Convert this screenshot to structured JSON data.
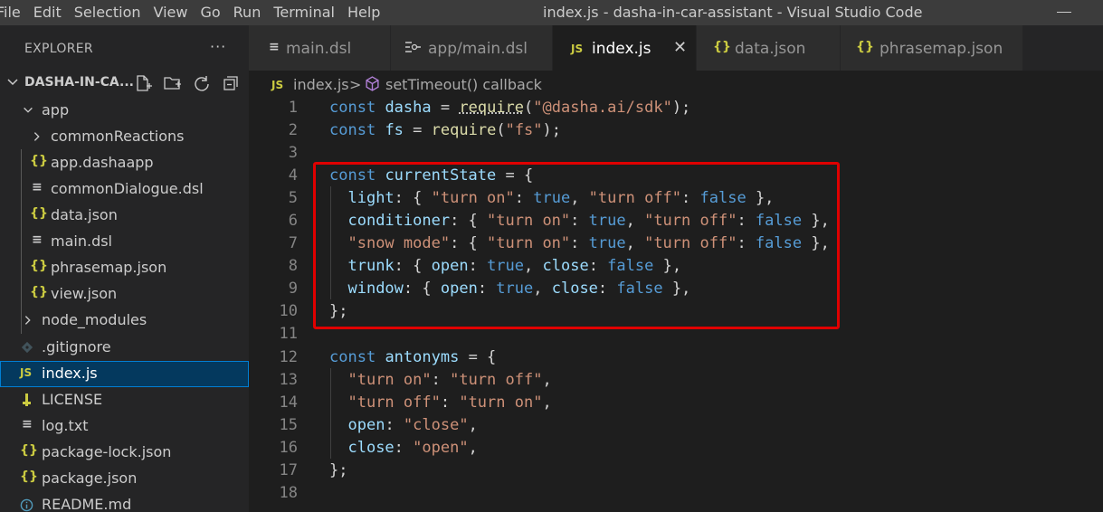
{
  "menu": [
    "File",
    "Edit",
    "Selection",
    "View",
    "Go",
    "Run",
    "Terminal",
    "Help"
  ],
  "window_title": "index.js - dasha-in-car-assistant - Visual Studio Code",
  "explorer": {
    "title": "EXPLORER",
    "more": "···",
    "workspace": "DASHA-IN-CA...",
    "tree": [
      {
        "label": "app",
        "icon": "chevron-down-icon",
        "kind": "folder"
      },
      {
        "label": "commonReactions",
        "icon": "chevron-right-icon",
        "kind": "folder"
      },
      {
        "label": "app.dashaapp",
        "icon_text": "{}",
        "kind": "json"
      },
      {
        "label": "commonDialogue.dsl",
        "icon_text": "≡",
        "kind": "text"
      },
      {
        "label": "data.json",
        "icon_text": "{}",
        "kind": "json"
      },
      {
        "label": "main.dsl",
        "icon_text": "≡",
        "kind": "text"
      },
      {
        "label": "phrasemap.json",
        "icon_text": "{}",
        "kind": "json"
      },
      {
        "label": "view.json",
        "icon_text": "{}",
        "kind": "json"
      },
      {
        "label": "node_modules",
        "icon": "chevron-right-icon",
        "kind": "folder"
      },
      {
        "label": ".gitignore",
        "icon": "git-icon",
        "kind": "git"
      },
      {
        "label": "index.js",
        "icon_text": "JS",
        "kind": "js"
      },
      {
        "label": "LICENSE",
        "icon": "license-icon",
        "kind": "license"
      },
      {
        "label": "log.txt",
        "icon_text": "≡",
        "kind": "text"
      },
      {
        "label": "package-lock.json",
        "icon_text": "{}",
        "kind": "json"
      },
      {
        "label": "package.json",
        "icon_text": "{}",
        "kind": "json"
      },
      {
        "label": "README.md",
        "icon": "info-icon",
        "kind": "info"
      }
    ]
  },
  "tabs": [
    {
      "label": "main.dsl",
      "icon_text": "≡",
      "active": false
    },
    {
      "label": "app/main.dsl",
      "icon": "dsl-file-icon",
      "active": false
    },
    {
      "label": "index.js",
      "icon_text": "JS",
      "active": true,
      "close": "✕"
    },
    {
      "label": "data.json",
      "icon_text": "{}",
      "active": false
    },
    {
      "label": "phrasemap.json",
      "icon_text": "{}",
      "active": false
    }
  ],
  "breadcrumb": {
    "file": "index.js",
    "separator": ">",
    "symbol": "setTimeout() callback"
  },
  "code_lines": [
    {
      "n": "1"
    },
    {
      "n": "2"
    },
    {
      "n": "3"
    },
    {
      "n": "4"
    },
    {
      "n": "5"
    },
    {
      "n": "6"
    },
    {
      "n": "7"
    },
    {
      "n": "8"
    },
    {
      "n": "9"
    },
    {
      "n": "10"
    },
    {
      "n": "11"
    },
    {
      "n": "12"
    },
    {
      "n": "13"
    },
    {
      "n": "14"
    },
    {
      "n": "15"
    },
    {
      "n": "16"
    },
    {
      "n": "17"
    },
    {
      "n": "18"
    }
  ],
  "code": {
    "l1": {
      "kw": "const",
      "var": "dasha",
      "eq": "=",
      "fn": "require",
      "open": "(",
      "str": "\"@dasha.ai/sdk\"",
      "close": ");"
    },
    "l2": {
      "kw": "const",
      "var": "fs",
      "eq": "=",
      "fn": "require",
      "open": "(",
      "str": "\"fs\"",
      "close": ");"
    },
    "l4": {
      "kw": "const",
      "var": "currentState",
      "rest": "= {"
    },
    "l5": {
      "key": "light",
      "a": ": { ",
      "s1": "\"turn on\"",
      "c1": ": ",
      "b1": "true",
      "m": ", ",
      "s2": "\"turn off\"",
      "c2": ": ",
      "b2": "false",
      "end": " },"
    },
    "l6": {
      "key": "conditioner",
      "a": ": { ",
      "s1": "\"turn on\"",
      "c1": ": ",
      "b1": "true",
      "m": ", ",
      "s2": "\"turn off\"",
      "c2": ": ",
      "b2": "false",
      "end": " },"
    },
    "l7": {
      "skey": "\"snow mode\"",
      "a": ": { ",
      "s1": "\"turn on\"",
      "c1": ": ",
      "b1": "true",
      "m": ", ",
      "s2": "\"turn off\"",
      "c2": ": ",
      "b2": "false",
      "end": " },"
    },
    "l8": {
      "key": "trunk",
      "a": ": { ",
      "k1": "open",
      "c1": ": ",
      "b1": "true",
      "m": ", ",
      "k2": "close",
      "c2": ": ",
      "b2": "false",
      "end": " },"
    },
    "l9": {
      "key": "window",
      "a": ": { ",
      "k1": "open",
      "c1": ": ",
      "b1": "true",
      "m": ", ",
      "k2": "close",
      "c2": ": ",
      "b2": "false",
      "end": " },"
    },
    "l10": {
      "p": "};"
    },
    "l12": {
      "kw": "const",
      "var": "antonyms",
      "rest": "= {"
    },
    "l13": {
      "s1": "\"turn on\"",
      "c": ": ",
      "s2": "\"turn off\"",
      "end": ","
    },
    "l14": {
      "s1": "\"turn off\"",
      "c": ": ",
      "s2": "\"turn on\"",
      "end": ","
    },
    "l15": {
      "k": "open",
      "c": ": ",
      "s": "\"close\"",
      "end": ","
    },
    "l16": {
      "k": "close",
      "c": ": ",
      "s": "\"open\"",
      "end": ","
    },
    "l17": {
      "p": "};"
    }
  },
  "colors": {
    "title_bar": "#3c3c3c",
    "sidebar": "#252526",
    "editor": "#1e1e1e",
    "highlight_box": "#e00000",
    "json_icon": "#cbcb41",
    "js_icon": "#cbcb41",
    "keyword": "#569cd6",
    "variable": "#9cdcfe",
    "string": "#ce9178"
  }
}
